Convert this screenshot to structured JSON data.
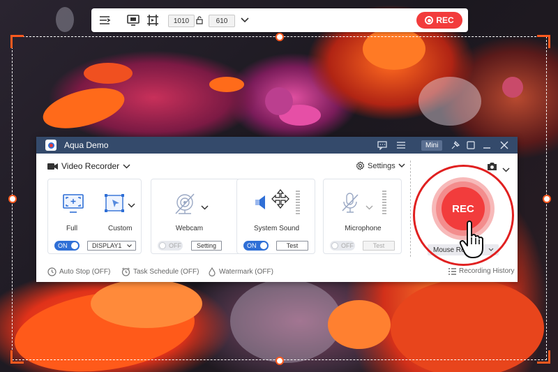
{
  "toolbar": {
    "width_value": "1010",
    "height_value": "610",
    "rec_label": "REC"
  },
  "app": {
    "title": "Aqua Demo",
    "mini_label": "Mini",
    "mode_label": "Video Recorder",
    "settings_label": "Settings"
  },
  "cards": {
    "display": {
      "full_label": "Full",
      "custom_label": "Custom",
      "toggle": "ON",
      "select_value": "DISPLAY1"
    },
    "webcam": {
      "label": "Webcam",
      "toggle": "OFF",
      "button": "Setting"
    },
    "system_sound": {
      "label": "System Sound",
      "toggle": "ON",
      "button": "Test"
    },
    "microphone": {
      "label": "Microphone",
      "toggle": "OFF",
      "button": "Test"
    }
  },
  "record": {
    "rec_label": "REC",
    "mouse_label": "Mouse Re"
  },
  "bottom": {
    "auto_stop": "Auto Stop (OFF)",
    "task_schedule": "Task Schedule (OFF)",
    "watermark": "Watermark (OFF)",
    "history": "Recording History"
  },
  "colors": {
    "accent_blue": "#2f6fd6",
    "rec_red": "#f23c3c",
    "titlebar": "#344a6b",
    "frame_orange": "#ff5a1f"
  }
}
